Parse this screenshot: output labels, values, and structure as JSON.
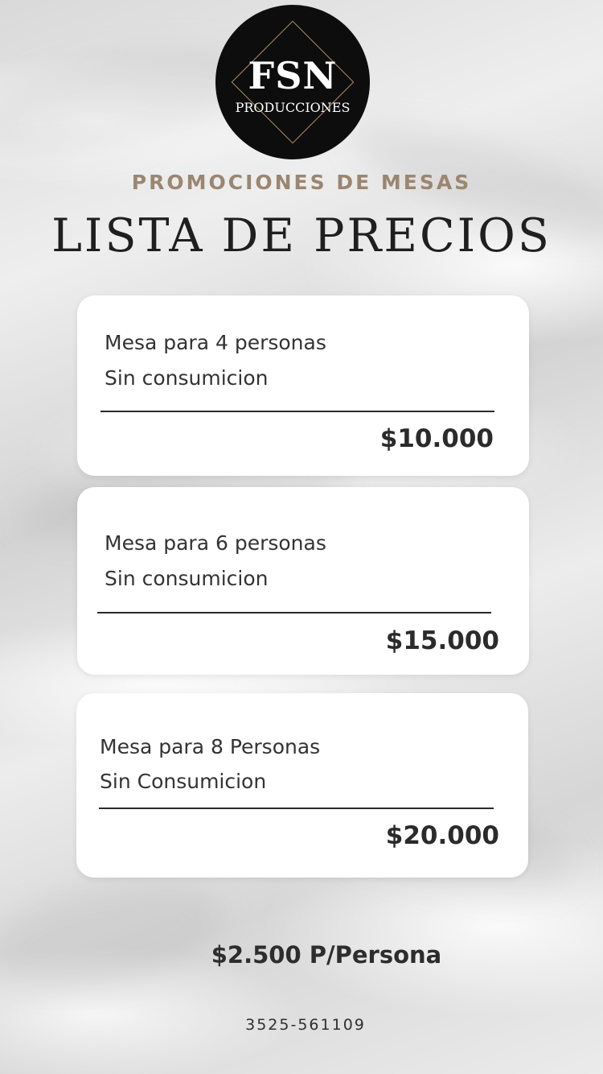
{
  "logo": {
    "main": "FSN",
    "sub": "PRODUCCIONES"
  },
  "subtitle": "PROMOCIONES DE MESAS",
  "title": "LISTA DE PRECIOS",
  "cards": [
    {
      "line1": "Mesa para 4 personas",
      "line2": "Sin consumicion",
      "price": "$10.000"
    },
    {
      "line1": "Mesa para 6 personas",
      "line2": "Sin consumicion",
      "price": "$15.000"
    },
    {
      "line1": "Mesa para 8 Personas",
      "line2": "Sin Consumicion",
      "price": "$20.000"
    }
  ],
  "per_person": "$2.500 P/Persona",
  "phone": "3525-561109",
  "colors": {
    "accent": "#9b8670",
    "logo_bg": "#0d0d0d",
    "card_bg": "#ffffff"
  }
}
